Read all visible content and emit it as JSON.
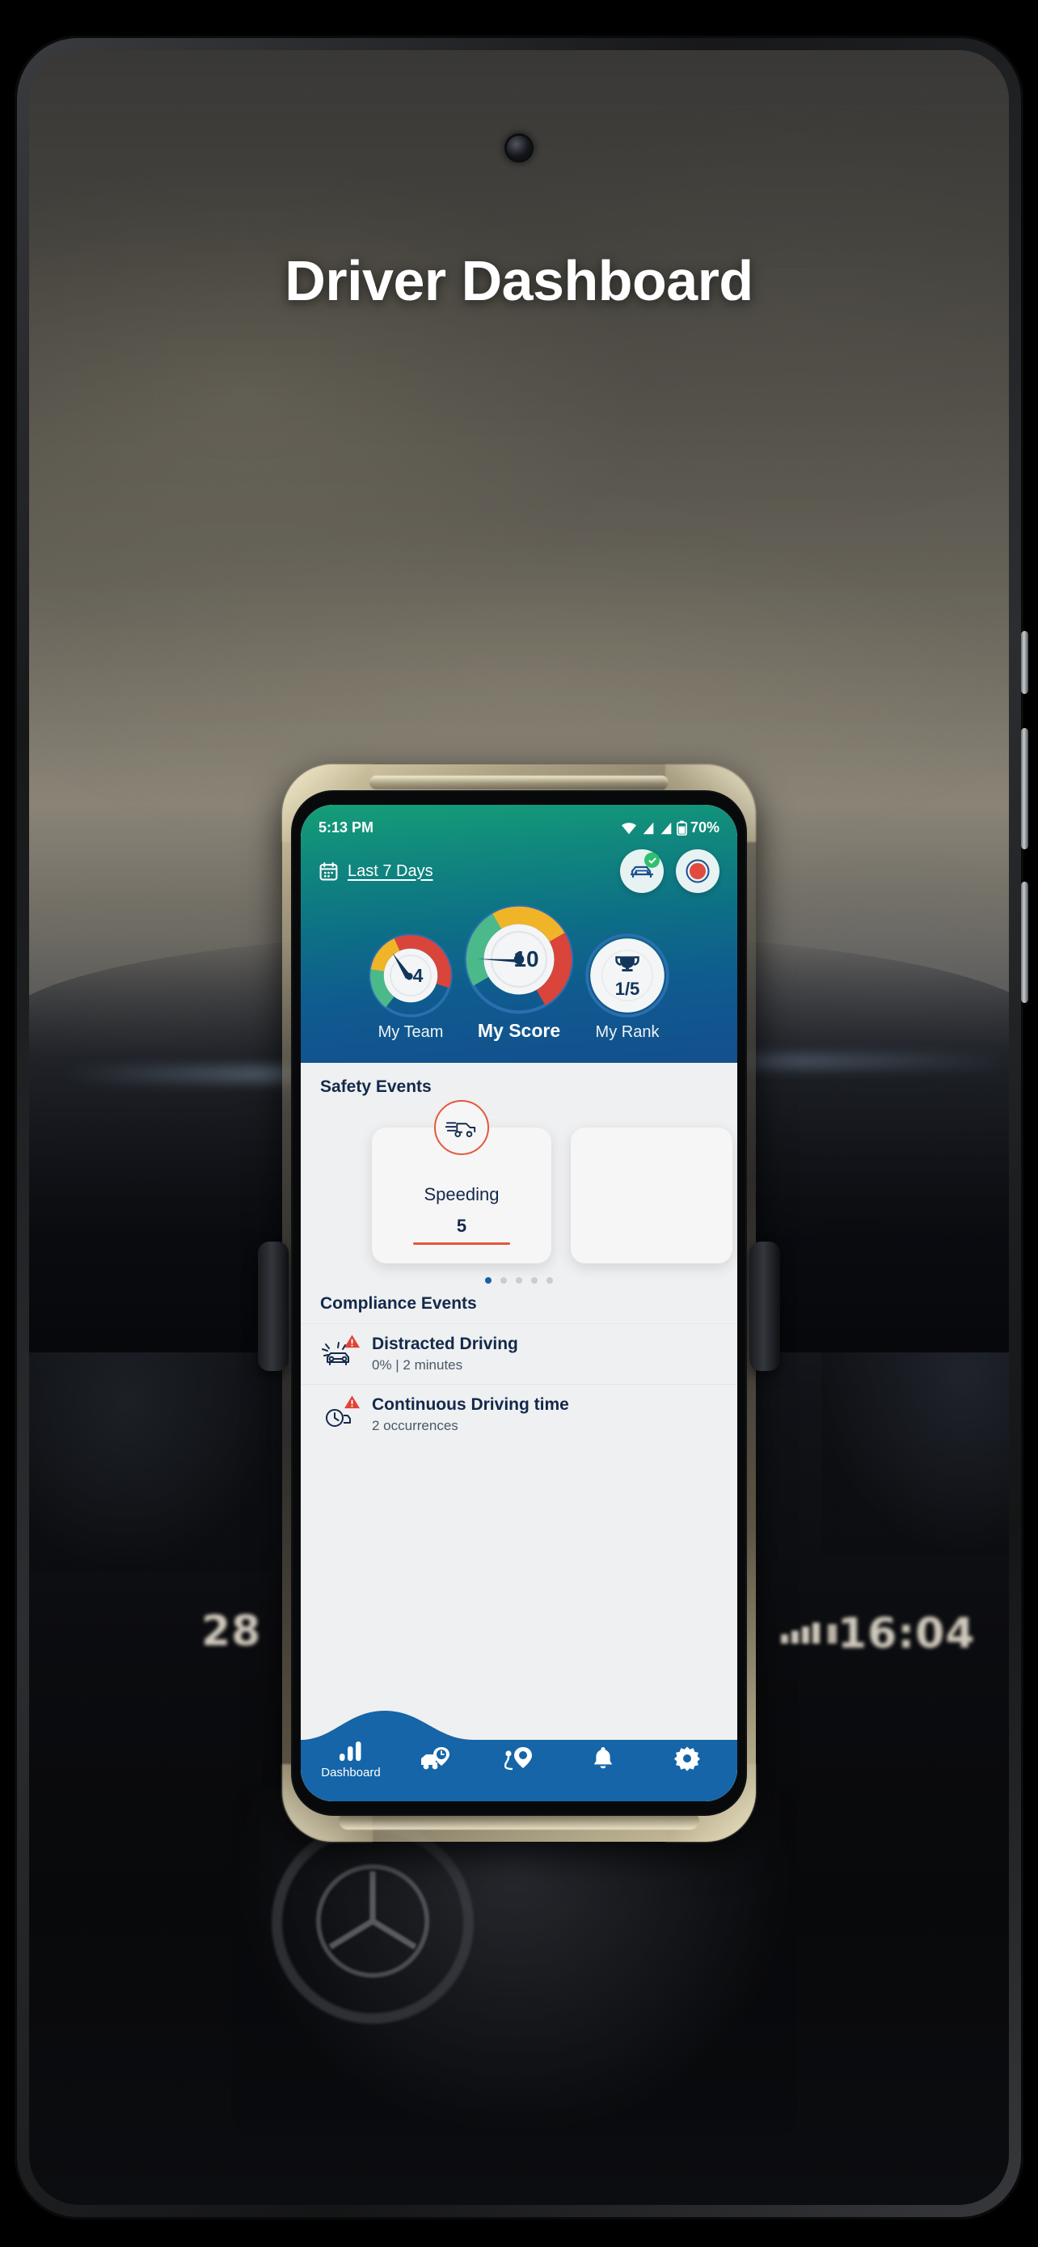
{
  "page": {
    "title": "Driver Dashboard"
  },
  "background": {
    "cluster_speed": "28",
    "cluster_time": "16:04"
  },
  "app": {
    "statusbar": {
      "time": "5:13 PM",
      "battery_percent": "70%",
      "icons": [
        "wifi-icon",
        "signal-icon",
        "signal-icon",
        "battery-icon"
      ]
    },
    "header": {
      "date_filter": {
        "icon": "calendar-icon",
        "label": "Last 7 Days"
      },
      "actions": [
        {
          "name": "vehicle-status-button",
          "icon": "car-icon",
          "badge": "check-badge"
        },
        {
          "name": "record-trip-button",
          "icon": "record-icon"
        }
      ],
      "gauges": [
        {
          "name": "my-team-gauge",
          "caption": "My Team",
          "value": "4",
          "icon": null,
          "size": "small"
        },
        {
          "name": "my-score-gauge",
          "caption": "My Score",
          "value": "10",
          "icon": null,
          "size": "large"
        },
        {
          "name": "my-rank-gauge",
          "caption": "My Rank",
          "value": "1/5",
          "icon": "trophy-icon",
          "size": "small"
        }
      ]
    },
    "safety": {
      "section_title": "Safety Events",
      "cards": [
        {
          "icon": "speeding-truck-icon",
          "name": "Speeding",
          "value": "5"
        }
      ],
      "dots_total": 5,
      "dots_active": 1
    },
    "compliance": {
      "section_title": "Compliance Events",
      "rows": [
        {
          "icon": "distracted-driving-icon",
          "title": "Distracted Driving",
          "subtitle": "0% | 2 minutes",
          "alert": "warning-icon"
        },
        {
          "icon": "driving-time-icon",
          "title": "Continuous Driving time",
          "subtitle": "2 occurrences",
          "alert": "warning-icon"
        }
      ]
    },
    "nav": {
      "items": [
        {
          "name": "nav-dashboard",
          "icon": "bar-chart-icon",
          "label": "Dashboard",
          "active": true
        },
        {
          "name": "nav-trips",
          "icon": "truck-clock-icon",
          "label": "",
          "active": false
        },
        {
          "name": "nav-locations",
          "icon": "map-pin-icon",
          "label": "",
          "active": false
        },
        {
          "name": "nav-alerts",
          "icon": "bell-icon",
          "label": "",
          "active": false
        },
        {
          "name": "nav-settings",
          "icon": "gear-icon",
          "label": "",
          "active": false
        }
      ]
    }
  },
  "colors": {
    "header_green": "#159e77",
    "header_blue": "#134f8e",
    "nav_blue": "#1565a8",
    "accent_red": "#e4573c",
    "gauge_green": "#4bb98a",
    "gauge_yellow": "#f0b429",
    "gauge_red": "#d9443b",
    "text_navy": "#13294b"
  }
}
